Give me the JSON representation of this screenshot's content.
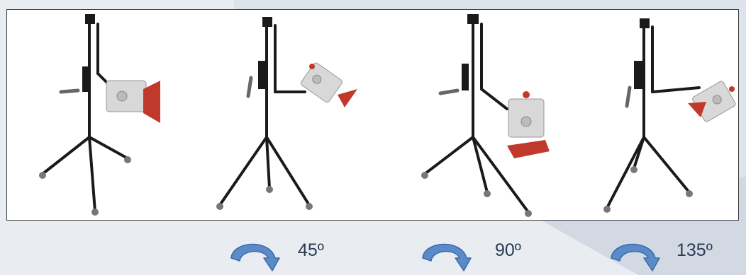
{
  "rotations": [
    {
      "label": "45º"
    },
    {
      "label": "90º"
    },
    {
      "label": "135º"
    }
  ],
  "colors": {
    "background": "#e9edf2",
    "background_band": "#d6dde6",
    "frame_border": "#3c3c3c",
    "arrow_fill": "#5b8ac9",
    "arrow_stroke": "#3d6aa8",
    "label_text": "#2a3b56",
    "stand_metal": "#1a1a1a",
    "housing": "#d8d8d8",
    "hood": "#c0392b"
  },
  "icons": [
    "rotate-clockwise-arrow-icon"
  ]
}
